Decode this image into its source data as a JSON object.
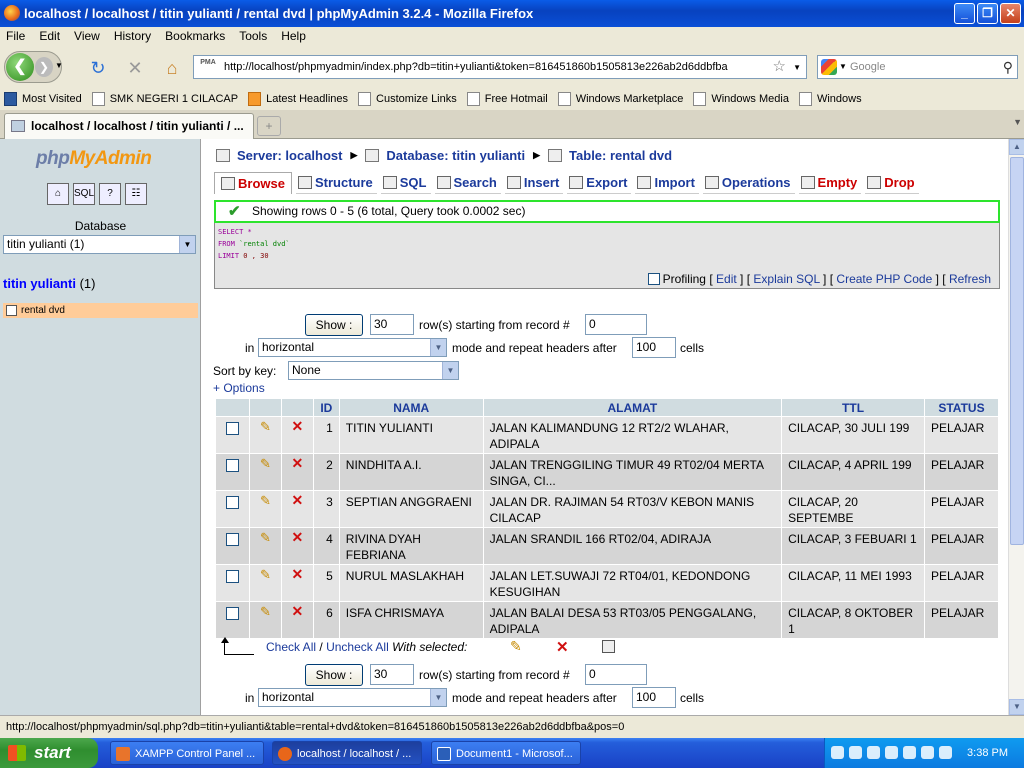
{
  "window": {
    "title": "localhost / localhost / titin yulianti / rental dvd | phpMyAdmin 3.2.4 - Mozilla Firefox",
    "buttons": [
      "_",
      "❐",
      "✕"
    ]
  },
  "menu": [
    "File",
    "Edit",
    "View",
    "History",
    "Bookmarks",
    "Tools",
    "Help"
  ],
  "nav": {
    "url": "http://localhost/phpmyadmin/index.php?db=titin+yulianti&token=816451860b1505813e226ab2d6ddbfba",
    "search_placeholder": "Google",
    "url_favicon": "PMA"
  },
  "bookmarks": [
    {
      "label": "Most Visited",
      "icon": "most-visited"
    },
    {
      "label": "SMK NEGERI 1 CILACAP",
      "icon": "page"
    },
    {
      "label": "Latest Headlines",
      "icon": "rss"
    },
    {
      "label": "Customize Links",
      "icon": "page"
    },
    {
      "label": "Free Hotmail",
      "icon": "page"
    },
    {
      "label": "Windows Marketplace",
      "icon": "page"
    },
    {
      "label": "Windows Media",
      "icon": "page"
    },
    {
      "label": "Windows",
      "icon": "page"
    }
  ],
  "tab": {
    "title": "localhost / localhost / titin yulianti / ..."
  },
  "left": {
    "logo_php": "php",
    "logo_my": "MyAdmin",
    "icons": [
      "home-icon",
      "sql-query-icon",
      "query-window-icon",
      "docs-icon"
    ],
    "database_label": "Database",
    "database_select": "titin yulianti (1)",
    "db_name": "titin yulianti",
    "db_count": "(1)",
    "table_item": "rental dvd"
  },
  "breadcrumb": {
    "server": "Server: localhost",
    "database": "Database: titin yulianti",
    "table": "Table: rental dvd"
  },
  "tabs": [
    {
      "label": "Browse",
      "active": true
    },
    {
      "label": "Structure"
    },
    {
      "label": "SQL"
    },
    {
      "label": "Search"
    },
    {
      "label": "Insert"
    },
    {
      "label": "Export"
    },
    {
      "label": "Import"
    },
    {
      "label": "Operations"
    },
    {
      "label": "Empty",
      "red": true
    },
    {
      "label": "Drop",
      "red": true
    }
  ],
  "message": "Showing rows 0 - 5 (6 total, Query took 0.0002 sec)",
  "sql": {
    "line1_kw": "SELECT",
    "line1_rest": " *",
    "line2_kw": "FROM",
    "line2_rest": " `rental dvd`",
    "line3_kw": "LIMIT",
    "line3_rest": " 0 , 30"
  },
  "sql_links": {
    "profiling": "Profiling",
    "edit": "Edit",
    "explain": "Explain SQL",
    "create_php": "Create PHP Code",
    "refresh": "Refresh",
    "open": "[",
    "close": "]"
  },
  "navigation": {
    "show_label": "Show :",
    "rows": "30",
    "rows_text": "row(s) starting from record #",
    "start": "0",
    "in_label": "in",
    "mode": "horizontal",
    "mode_text": "mode and repeat headers after",
    "repeat": "100",
    "cells_text": "cells",
    "sort_label": "Sort by key:",
    "sort_value": "None",
    "options_link": "+ Options"
  },
  "table": {
    "columns": [
      "ID",
      "NAMA",
      "ALAMAT",
      "TTL",
      "STATUS"
    ],
    "rows": [
      {
        "id": "1",
        "nama": "TITIN YULIANTI",
        "alamat": "JALAN KALIMANDUNG 12 RT2/2 WLAHAR, ADIPALA",
        "ttl": "CILACAP, 30 JULI 199",
        "status": "PELAJAR"
      },
      {
        "id": "2",
        "nama": "NINDHITA A.I.",
        "alamat": "JALAN TRENGGILING TIMUR 49 RT02/04 MERTA SINGA, CI...",
        "ttl": "CILACAP, 4 APRIL 199",
        "status": "PELAJAR"
      },
      {
        "id": "3",
        "nama": "SEPTIAN ANGGRAENI",
        "alamat": "JALAN DR. RAJIMAN 54 RT03/V KEBON MANIS CILACAP",
        "ttl": "CILACAP, 20 SEPTEMBE",
        "status": "PELAJAR"
      },
      {
        "id": "4",
        "nama": "RIVINA DYAH FEBRIANA",
        "alamat": "JALAN SRANDIL 166 RT02/04, ADIRAJA",
        "ttl": "CILACAP, 3 FEBUARI 1",
        "status": "PELAJAR"
      },
      {
        "id": "5",
        "nama": "NURUL MASLAKHAH",
        "alamat": "JALAN LET.SUWAJI 72 RT04/01, KEDONDONG KESUGIHAN",
        "ttl": "CILACAP, 11 MEI 1993",
        "status": "PELAJAR"
      },
      {
        "id": "6",
        "nama": "ISFA CHRISMAYA",
        "alamat": "JALAN BALAI DESA 53 RT03/05 PENGGALANG, ADIPALA",
        "ttl": "CILACAP, 8 OKTOBER 1",
        "status": "PELAJAR"
      }
    ]
  },
  "bulk": {
    "check_all": "Check All",
    "separator": "/",
    "uncheck_all": "Uncheck All",
    "with_selected": "With selected:"
  },
  "status_bar": "http://localhost/phpmyadmin/sql.php?db=titin+yulianti&table=rental+dvd&token=816451860b1505813e226ab2d6ddbfba&pos=0",
  "taskbar": {
    "start": "start",
    "items": [
      "XAMPP Control Panel ...",
      "localhost / localhost / ...",
      "Document1 - Microsof..."
    ],
    "clock": "3:38 PM"
  }
}
